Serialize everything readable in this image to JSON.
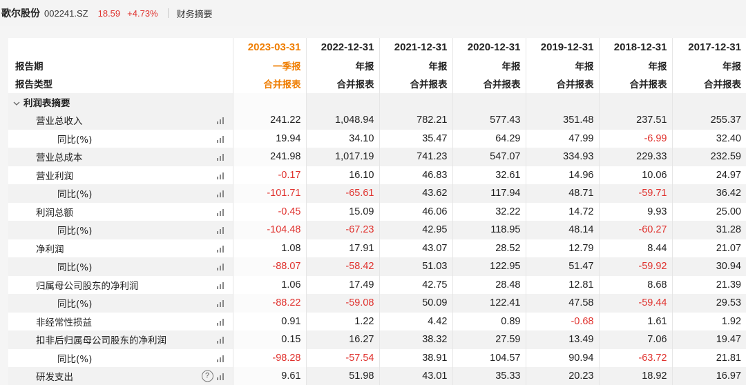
{
  "topbar": {
    "stock_name": "歌尔股份",
    "stock_code": "002241.SZ",
    "price": "18.59",
    "change_pct": "+4.73%",
    "section_label": "财务摘要"
  },
  "table": {
    "header_labels": {
      "period": "报告期",
      "report_period_row": "报告期",
      "report_type": "报告类型"
    },
    "periods": [
      "2023-03-31",
      "2022-12-31",
      "2021-12-31",
      "2020-12-31",
      "2019-12-31",
      "2018-12-31",
      "2017-12-31"
    ],
    "period_types": [
      "一季报",
      "年报",
      "年报",
      "年报",
      "年报",
      "年报",
      "年报"
    ],
    "report_types": [
      "合并报表",
      "合并报表",
      "合并报表",
      "合并报表",
      "合并报表",
      "合并报表",
      "合并报表"
    ],
    "group_title": "利润表摘要",
    "rows": [
      {
        "label": "营业总收入",
        "level": 1,
        "values": [
          "241.22",
          "1,048.94",
          "782.21",
          "577.43",
          "351.48",
          "237.51",
          "255.37"
        ]
      },
      {
        "label": "同比(%)",
        "level": 2,
        "values": [
          "19.94",
          "34.10",
          "35.47",
          "64.29",
          "47.99",
          "-6.99",
          "32.40"
        ]
      },
      {
        "label": "营业总成本",
        "level": 1,
        "values": [
          "241.98",
          "1,017.19",
          "741.23",
          "547.07",
          "334.93",
          "229.33",
          "232.59"
        ]
      },
      {
        "label": "营业利润",
        "level": 1,
        "values": [
          "-0.17",
          "16.10",
          "46.83",
          "32.61",
          "14.96",
          "10.06",
          "24.97"
        ]
      },
      {
        "label": "同比(%)",
        "level": 2,
        "values": [
          "-101.71",
          "-65.61",
          "43.62",
          "117.94",
          "48.71",
          "-59.71",
          "36.42"
        ]
      },
      {
        "label": "利润总额",
        "level": 1,
        "values": [
          "-0.45",
          "15.09",
          "46.06",
          "32.22",
          "14.72",
          "9.93",
          "25.00"
        ]
      },
      {
        "label": "同比(%)",
        "level": 2,
        "values": [
          "-104.48",
          "-67.23",
          "42.95",
          "118.95",
          "48.14",
          "-60.27",
          "31.28"
        ]
      },
      {
        "label": "净利润",
        "level": 1,
        "values": [
          "1.08",
          "17.91",
          "43.07",
          "28.52",
          "12.79",
          "8.44",
          "21.07"
        ]
      },
      {
        "label": "同比(%)",
        "level": 2,
        "values": [
          "-88.07",
          "-58.42",
          "51.03",
          "122.95",
          "51.47",
          "-59.92",
          "30.94"
        ]
      },
      {
        "label": "归属母公司股东的净利润",
        "level": 1,
        "values": [
          "1.06",
          "17.49",
          "42.75",
          "28.48",
          "12.81",
          "8.68",
          "21.39"
        ]
      },
      {
        "label": "同比(%)",
        "level": 2,
        "values": [
          "-88.22",
          "-59.08",
          "50.09",
          "122.41",
          "47.58",
          "-59.44",
          "29.53"
        ]
      },
      {
        "label": "非经常性损益",
        "level": 1,
        "values": [
          "0.91",
          "1.22",
          "4.42",
          "0.89",
          "-0.68",
          "1.61",
          "1.92"
        ]
      },
      {
        "label": "扣非后归属母公司股东的净利润",
        "level": 1,
        "values": [
          "0.15",
          "16.27",
          "38.32",
          "27.59",
          "13.49",
          "7.06",
          "19.47"
        ]
      },
      {
        "label": "同比(%)",
        "level": 2,
        "values": [
          "-98.28",
          "-57.54",
          "38.91",
          "104.57",
          "90.94",
          "-63.72",
          "21.81"
        ]
      },
      {
        "label": "研发支出",
        "level": 1,
        "values": [
          "9.61",
          "51.98",
          "43.01",
          "35.33",
          "20.23",
          "18.92",
          "16.97"
        ],
        "help": "?"
      }
    ]
  },
  "icons": {
    "row_chart": "bar-chart-icon",
    "collapse": "chevron-down-icon",
    "help": "question-circle-icon"
  },
  "colors": {
    "negative": "#e0322e",
    "positive_change": "#e0322e",
    "latest_period": "#ef7d00"
  }
}
